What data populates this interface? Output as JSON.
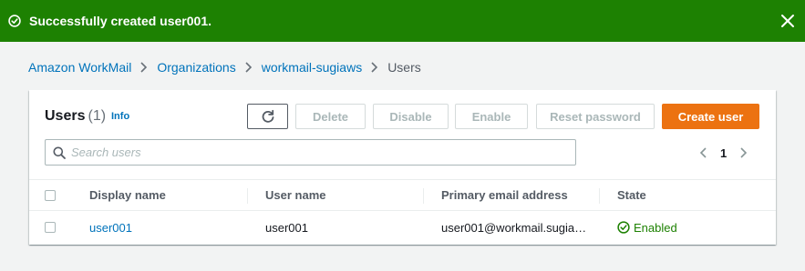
{
  "flash": {
    "message": "Successfully created user001.",
    "status_icon": "check-circle-icon",
    "dismiss_icon": "close-icon",
    "color": "#1d8102"
  },
  "breadcrumb": {
    "items": [
      "Amazon WorkMail",
      "Organizations",
      "workmail-sugiaws"
    ],
    "current": "Users"
  },
  "panel": {
    "title": "Users",
    "count": "(1)",
    "info": "Info"
  },
  "toolbar": {
    "refresh_icon": "refresh-icon",
    "delete_label": "Delete",
    "disable_label": "Disable",
    "enable_label": "Enable",
    "reset_label": "Reset password",
    "create_label": "Create user",
    "primary_color": "#ec7211"
  },
  "search": {
    "placeholder": "Search users",
    "value": ""
  },
  "pagination": {
    "current_page": "1"
  },
  "table": {
    "columns": [
      "Display name",
      "User name",
      "Primary email address",
      "State"
    ],
    "rows": [
      {
        "display_name": "user001",
        "user_name": "user001",
        "email": "user001@workmail.sugia…",
        "state": "Enabled"
      }
    ]
  }
}
